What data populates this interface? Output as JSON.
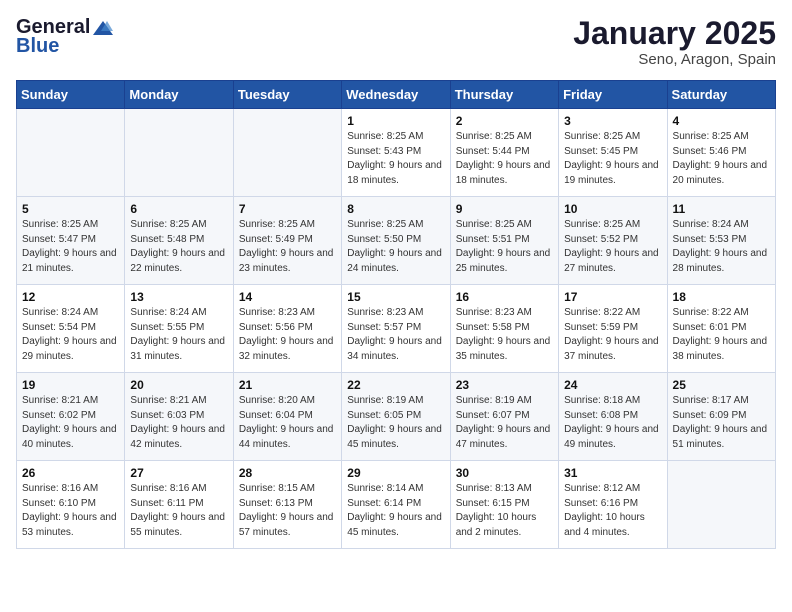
{
  "logo": {
    "general": "General",
    "blue": "Blue"
  },
  "title": "January 2025",
  "subtitle": "Seno, Aragon, Spain",
  "weekdays": [
    "Sunday",
    "Monday",
    "Tuesday",
    "Wednesday",
    "Thursday",
    "Friday",
    "Saturday"
  ],
  "weeks": [
    [
      {
        "day": "",
        "sunrise": "",
        "sunset": "",
        "daylight": ""
      },
      {
        "day": "",
        "sunrise": "",
        "sunset": "",
        "daylight": ""
      },
      {
        "day": "",
        "sunrise": "",
        "sunset": "",
        "daylight": ""
      },
      {
        "day": "1",
        "sunrise": "Sunrise: 8:25 AM",
        "sunset": "Sunset: 5:43 PM",
        "daylight": "Daylight: 9 hours and 18 minutes."
      },
      {
        "day": "2",
        "sunrise": "Sunrise: 8:25 AM",
        "sunset": "Sunset: 5:44 PM",
        "daylight": "Daylight: 9 hours and 18 minutes."
      },
      {
        "day": "3",
        "sunrise": "Sunrise: 8:25 AM",
        "sunset": "Sunset: 5:45 PM",
        "daylight": "Daylight: 9 hours and 19 minutes."
      },
      {
        "day": "4",
        "sunrise": "Sunrise: 8:25 AM",
        "sunset": "Sunset: 5:46 PM",
        "daylight": "Daylight: 9 hours and 20 minutes."
      }
    ],
    [
      {
        "day": "5",
        "sunrise": "Sunrise: 8:25 AM",
        "sunset": "Sunset: 5:47 PM",
        "daylight": "Daylight: 9 hours and 21 minutes."
      },
      {
        "day": "6",
        "sunrise": "Sunrise: 8:25 AM",
        "sunset": "Sunset: 5:48 PM",
        "daylight": "Daylight: 9 hours and 22 minutes."
      },
      {
        "day": "7",
        "sunrise": "Sunrise: 8:25 AM",
        "sunset": "Sunset: 5:49 PM",
        "daylight": "Daylight: 9 hours and 23 minutes."
      },
      {
        "day": "8",
        "sunrise": "Sunrise: 8:25 AM",
        "sunset": "Sunset: 5:50 PM",
        "daylight": "Daylight: 9 hours and 24 minutes."
      },
      {
        "day": "9",
        "sunrise": "Sunrise: 8:25 AM",
        "sunset": "Sunset: 5:51 PM",
        "daylight": "Daylight: 9 hours and 25 minutes."
      },
      {
        "day": "10",
        "sunrise": "Sunrise: 8:25 AM",
        "sunset": "Sunset: 5:52 PM",
        "daylight": "Daylight: 9 hours and 27 minutes."
      },
      {
        "day": "11",
        "sunrise": "Sunrise: 8:24 AM",
        "sunset": "Sunset: 5:53 PM",
        "daylight": "Daylight: 9 hours and 28 minutes."
      }
    ],
    [
      {
        "day": "12",
        "sunrise": "Sunrise: 8:24 AM",
        "sunset": "Sunset: 5:54 PM",
        "daylight": "Daylight: 9 hours and 29 minutes."
      },
      {
        "day": "13",
        "sunrise": "Sunrise: 8:24 AM",
        "sunset": "Sunset: 5:55 PM",
        "daylight": "Daylight: 9 hours and 31 minutes."
      },
      {
        "day": "14",
        "sunrise": "Sunrise: 8:23 AM",
        "sunset": "Sunset: 5:56 PM",
        "daylight": "Daylight: 9 hours and 32 minutes."
      },
      {
        "day": "15",
        "sunrise": "Sunrise: 8:23 AM",
        "sunset": "Sunset: 5:57 PM",
        "daylight": "Daylight: 9 hours and 34 minutes."
      },
      {
        "day": "16",
        "sunrise": "Sunrise: 8:23 AM",
        "sunset": "Sunset: 5:58 PM",
        "daylight": "Daylight: 9 hours and 35 minutes."
      },
      {
        "day": "17",
        "sunrise": "Sunrise: 8:22 AM",
        "sunset": "Sunset: 5:59 PM",
        "daylight": "Daylight: 9 hours and 37 minutes."
      },
      {
        "day": "18",
        "sunrise": "Sunrise: 8:22 AM",
        "sunset": "Sunset: 6:01 PM",
        "daylight": "Daylight: 9 hours and 38 minutes."
      }
    ],
    [
      {
        "day": "19",
        "sunrise": "Sunrise: 8:21 AM",
        "sunset": "Sunset: 6:02 PM",
        "daylight": "Daylight: 9 hours and 40 minutes."
      },
      {
        "day": "20",
        "sunrise": "Sunrise: 8:21 AM",
        "sunset": "Sunset: 6:03 PM",
        "daylight": "Daylight: 9 hours and 42 minutes."
      },
      {
        "day": "21",
        "sunrise": "Sunrise: 8:20 AM",
        "sunset": "Sunset: 6:04 PM",
        "daylight": "Daylight: 9 hours and 44 minutes."
      },
      {
        "day": "22",
        "sunrise": "Sunrise: 8:19 AM",
        "sunset": "Sunset: 6:05 PM",
        "daylight": "Daylight: 9 hours and 45 minutes."
      },
      {
        "day": "23",
        "sunrise": "Sunrise: 8:19 AM",
        "sunset": "Sunset: 6:07 PM",
        "daylight": "Daylight: 9 hours and 47 minutes."
      },
      {
        "day": "24",
        "sunrise": "Sunrise: 8:18 AM",
        "sunset": "Sunset: 6:08 PM",
        "daylight": "Daylight: 9 hours and 49 minutes."
      },
      {
        "day": "25",
        "sunrise": "Sunrise: 8:17 AM",
        "sunset": "Sunset: 6:09 PM",
        "daylight": "Daylight: 9 hours and 51 minutes."
      }
    ],
    [
      {
        "day": "26",
        "sunrise": "Sunrise: 8:16 AM",
        "sunset": "Sunset: 6:10 PM",
        "daylight": "Daylight: 9 hours and 53 minutes."
      },
      {
        "day": "27",
        "sunrise": "Sunrise: 8:16 AM",
        "sunset": "Sunset: 6:11 PM",
        "daylight": "Daylight: 9 hours and 55 minutes."
      },
      {
        "day": "28",
        "sunrise": "Sunrise: 8:15 AM",
        "sunset": "Sunset: 6:13 PM",
        "daylight": "Daylight: 9 hours and 57 minutes."
      },
      {
        "day": "29",
        "sunrise": "Sunrise: 8:14 AM",
        "sunset": "Sunset: 6:14 PM",
        "daylight": "Daylight: 9 hours and 45 minutes."
      },
      {
        "day": "30",
        "sunrise": "Sunrise: 8:13 AM",
        "sunset": "Sunset: 6:15 PM",
        "daylight": "Daylight: 10 hours and 2 minutes."
      },
      {
        "day": "31",
        "sunrise": "Sunrise: 8:12 AM",
        "sunset": "Sunset: 6:16 PM",
        "daylight": "Daylight: 10 hours and 4 minutes."
      },
      {
        "day": "",
        "sunrise": "",
        "sunset": "",
        "daylight": ""
      }
    ]
  ]
}
